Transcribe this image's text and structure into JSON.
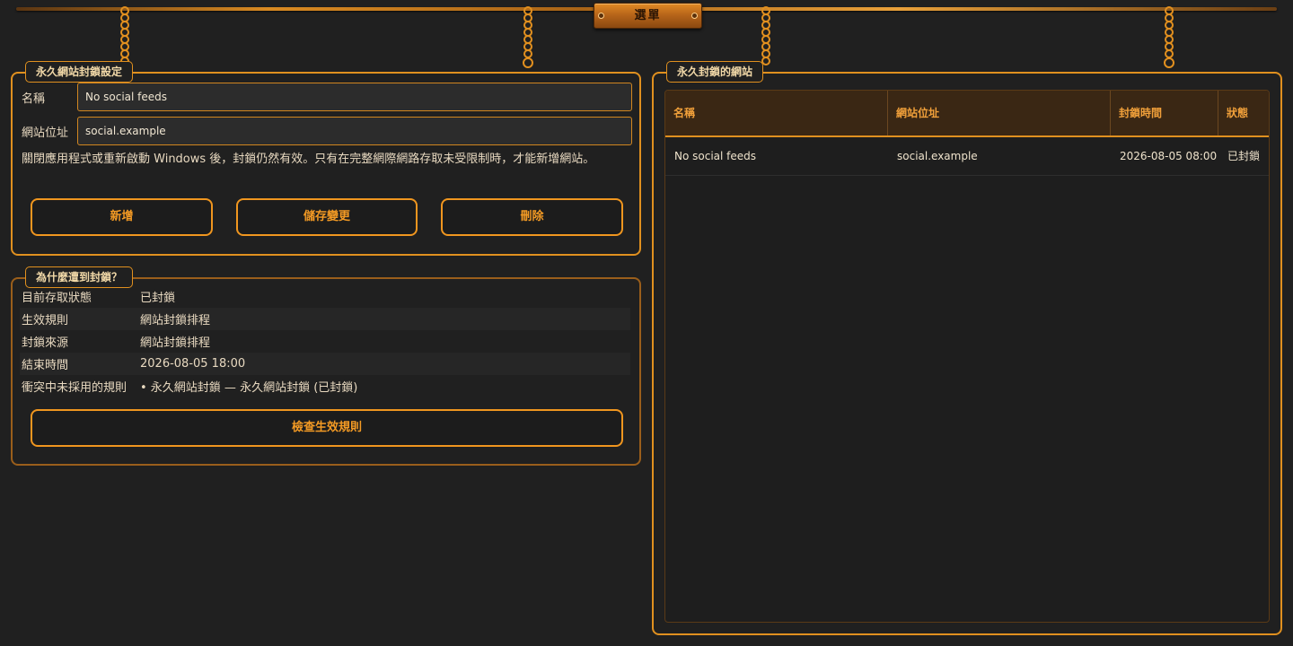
{
  "menu": {
    "label": "選單"
  },
  "settings_panel": {
    "title": "永久網站封鎖設定",
    "name_label": "名稱",
    "name_value": "No social feeds",
    "url_label": "網站位址",
    "url_value": "social.example",
    "note": "關閉應用程式或重新啟動 Windows 後，封鎖仍然有效。只有在完整網際網路存取未受限制時，才能新增網站。",
    "buttons": {
      "add": "新增",
      "save": "儲存變更",
      "delete": "刪除"
    }
  },
  "why_panel": {
    "title": "為什麼遭到封鎖？",
    "rows": [
      {
        "key": "目前存取狀態",
        "value": "已封鎖"
      },
      {
        "key": "生效規則",
        "value": "網站封鎖排程"
      },
      {
        "key": "封鎖來源",
        "value": "網站封鎖排程"
      },
      {
        "key": "結束時間",
        "value": "2026-08-05 18:00"
      },
      {
        "key": "衝突中未採用的規則",
        "value": "• 永久網站封鎖 — 永久網站封鎖 (已封鎖)"
      }
    ],
    "check_button": "檢查生效規則"
  },
  "sites_panel": {
    "title": "永久封鎖的網站",
    "columns": [
      "名稱",
      "網站位址",
      "封鎖時間",
      "狀態"
    ],
    "rows": [
      {
        "name": "No social feeds",
        "url": "social.example",
        "time": "2026-08-05 08:00",
        "status": "已封鎖"
      }
    ]
  },
  "colors": {
    "accent": "#f0961f",
    "background": "#202020",
    "header": "#3a2714"
  }
}
